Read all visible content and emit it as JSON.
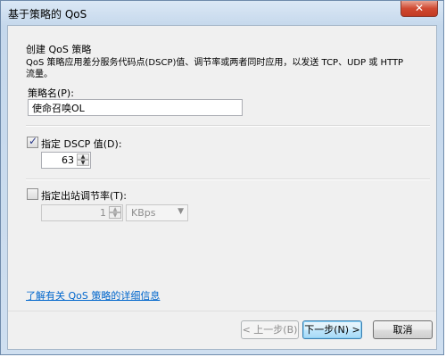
{
  "window": {
    "title": "基于策略的 QoS",
    "close_glyph": "✕"
  },
  "header": {
    "heading": "创建 QoS 策略",
    "description_line1": "QoS 策略应用差分服务代码点(DSCP)值、调节率或两者同时应用，以发送 TCP、UDP 或 HTTP",
    "description_line2": "流量。"
  },
  "policy_name": {
    "label": "策略名(P):",
    "value": "使命召唤OL"
  },
  "dscp": {
    "checked": true,
    "label": "指定 DSCP 值(D):",
    "value": "63",
    "spin_up": "▲",
    "spin_down": "▼"
  },
  "throttle": {
    "checked": false,
    "label": "指定出站调节率(T):",
    "value": "1",
    "unit": "KBps",
    "unit_arrow": "▼",
    "spin_up": "▲",
    "spin_down": "▼"
  },
  "learn_more_link": "了解有关 QoS 策略的详细信息",
  "buttons": {
    "back": "< 上一步(B)",
    "next": "下一步(N) >",
    "cancel": "取消"
  },
  "icons": {
    "check": "✓"
  }
}
